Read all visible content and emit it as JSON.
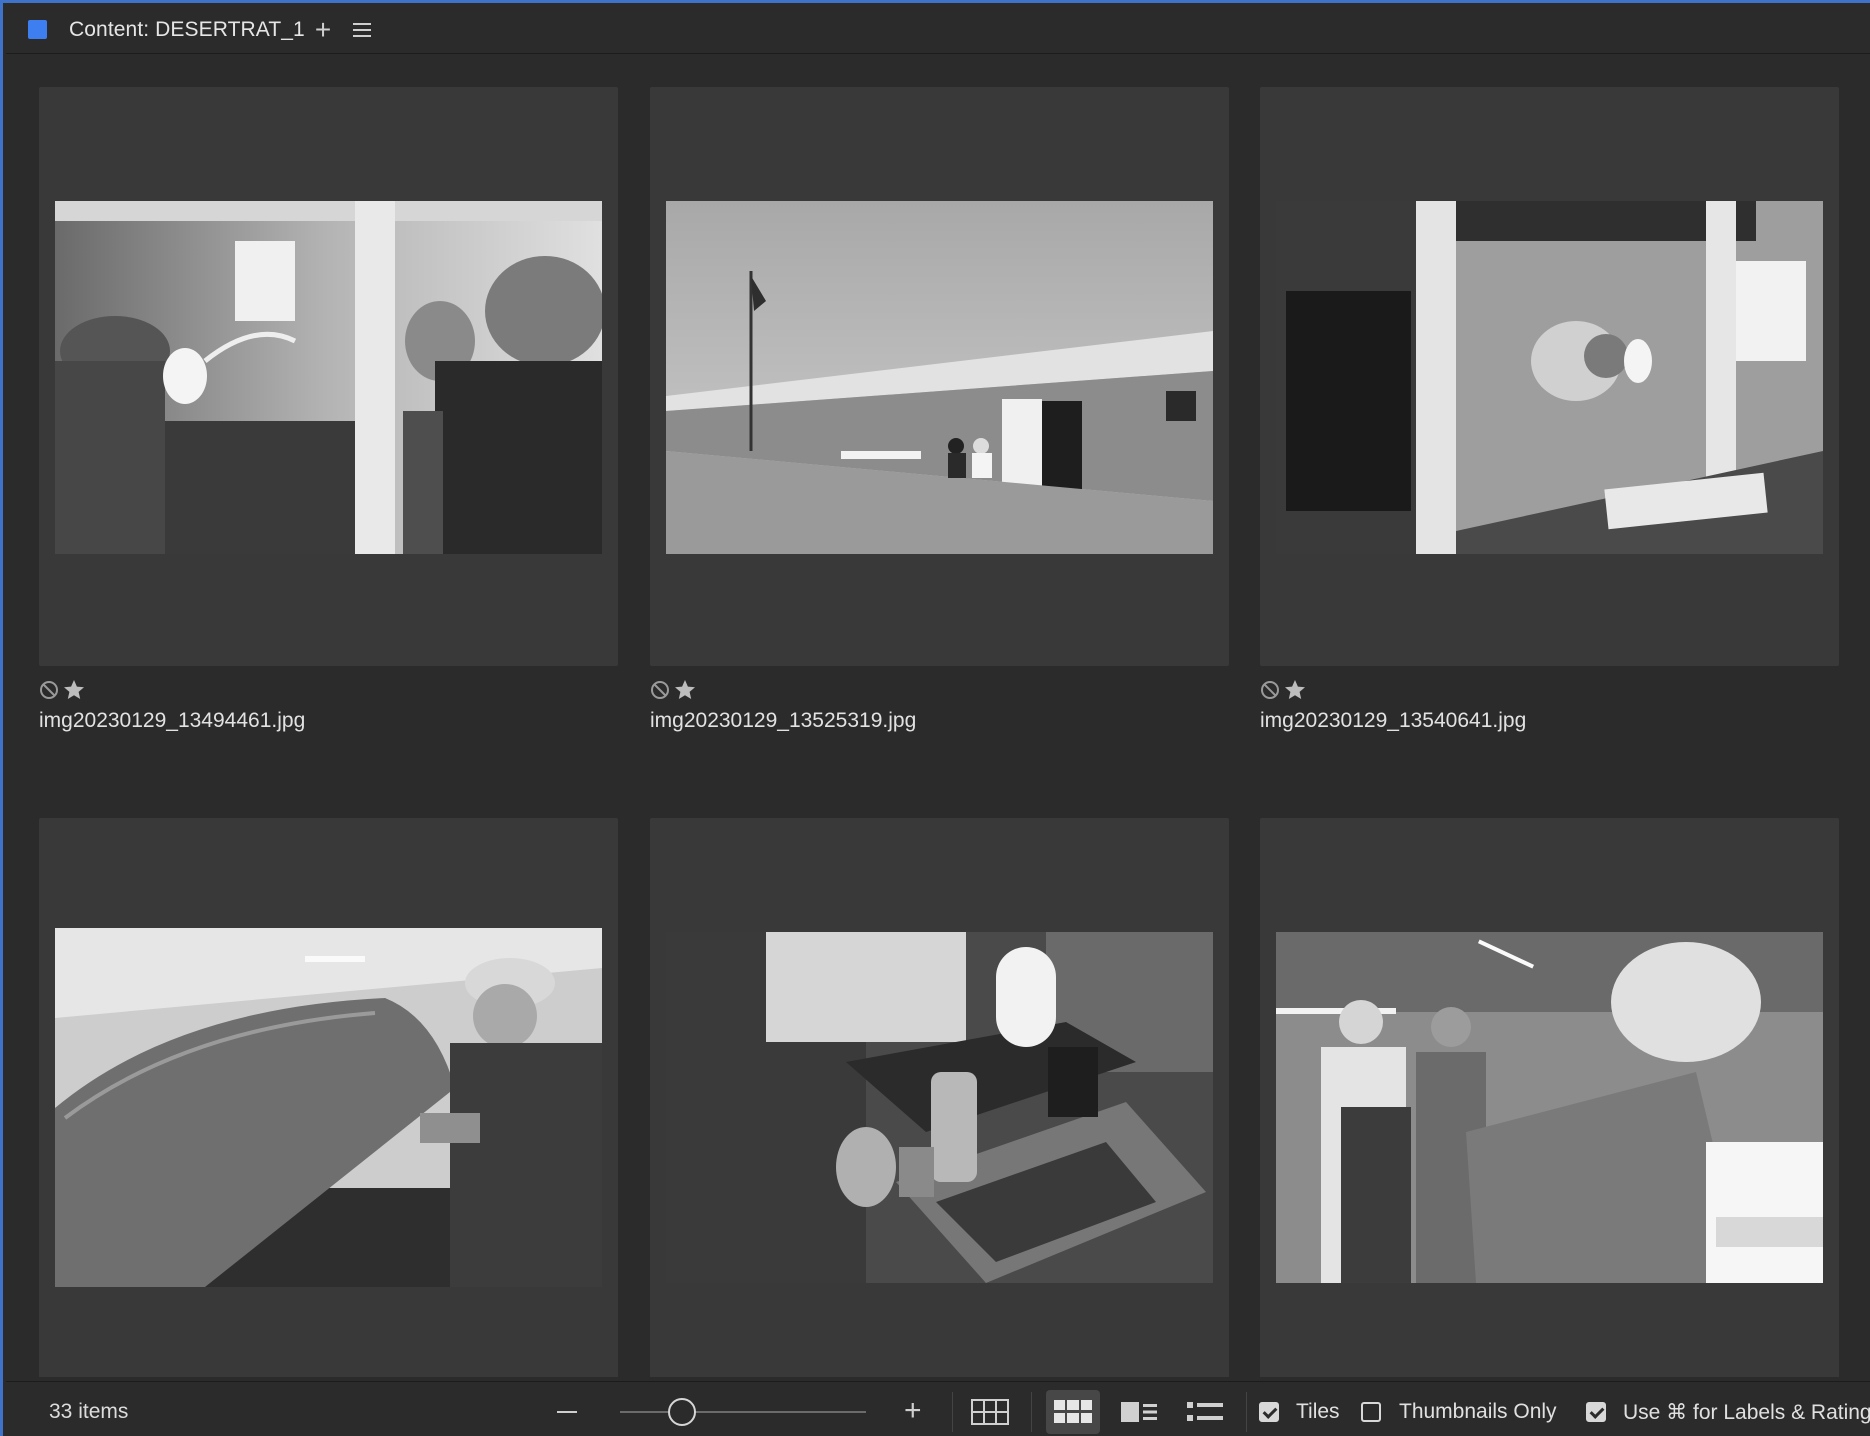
{
  "header": {
    "title": "Content: DESERTRAT_1",
    "swatch_color": "#3d7ef0",
    "add_icon": "plus-icon",
    "menu_icon": "hamburger-menu-icon"
  },
  "items": [
    {
      "filename": "img20230129_13494461.jpg",
      "scene": "workshop, two men in caps at a workbench with a lamp",
      "label_icon": "no-label-icon",
      "rating_icon": "star-icon"
    },
    {
      "filename": "img20230129_13525319.jpg",
      "scene": "long low building with a flag and two people seated outside",
      "label_icon": "no-label-icon",
      "rating_icon": "star-icon"
    },
    {
      "filename": "img20230129_13540641.jpg",
      "scene": "man in striped shirt working at a bench under a lamp",
      "label_icon": "no-label-icon",
      "rating_icon": "star-icon"
    },
    {
      "filename": "",
      "scene": "man in cap lifting a large metal saw guard",
      "label_icon": "no-label-icon",
      "rating_icon": "star-icon"
    },
    {
      "filename": "",
      "scene": "overhead view of workbench with lamp, jug and coffee can",
      "label_icon": "no-label-icon",
      "rating_icon": "star-icon"
    },
    {
      "filename": "",
      "scene": "man in cap working, two women in aprons behind",
      "label_icon": "no-label-icon",
      "rating_icon": "star-icon"
    }
  ],
  "footer": {
    "item_count": "33 items",
    "zoom_out_icon": "minus-icon",
    "zoom_in_icon": "plus-icon",
    "zoom_level": 0.25,
    "view_icons": [
      "grid-view-icon",
      "tile-view-icon",
      "filmstrip-view-icon",
      "list-view-icon"
    ],
    "tiles_label": "Tiles",
    "tiles_checked": true,
    "thumbnails_only_label": "Thumbnails Only",
    "thumbnails_only_checked": false,
    "use_cmd_label": "Use ⌘ for Labels & Rating",
    "use_cmd_checked": true
  }
}
